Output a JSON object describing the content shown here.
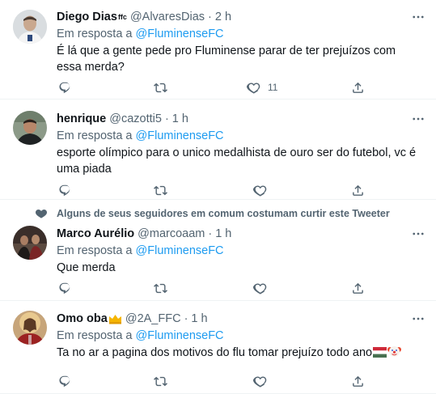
{
  "reply_prefix": "Em resposta a",
  "icons": {
    "more": "more-horizontal-icon",
    "reply": "reply-icon",
    "retweet": "retweet-icon",
    "like": "heart-icon",
    "share": "share-icon",
    "social_heart": "heart-filled-icon"
  },
  "colors": {
    "accent": "#1d9bf0",
    "secondary_text": "#536471",
    "text": "#0f1419",
    "divider": "#eff3f4"
  },
  "tweets": [
    {
      "name": "Diego Dias",
      "name_badge": "ffc",
      "handle": "@AlvaresDias",
      "separator": "·",
      "time": "2 h",
      "mention": "@FluminenseFC",
      "text": "É lá que a gente pede pro Fluminense parar de ter prejuízos com essa merda?",
      "likes": "11"
    },
    {
      "name": "henrique",
      "handle": "@cazotti5",
      "separator": "·",
      "time": "1 h",
      "mention": "@FluminenseFC",
      "text": "esporte olímpico para o unico medalhista de ouro ser do futebol, vc é uma piada"
    },
    {
      "social_context": "Alguns de seus seguidores em comum costumam curtir este Tweeter",
      "name": "Marco Aurélio",
      "handle": "@marcoaam",
      "separator": "·",
      "time": "1 h",
      "mention": "@FluminenseFC",
      "text": "Que merda"
    },
    {
      "name": "Omo oba",
      "name_emoji": "crown",
      "handle": "@2A_FFC",
      "separator": "·",
      "time": "1 h",
      "mention": "@FluminenseFC",
      "text": "Ta no ar a pagina dos motivos do flu tomar prejuízo todo ano",
      "text_emojis": [
        "flag-hungary",
        "clown-face"
      ]
    }
  ]
}
